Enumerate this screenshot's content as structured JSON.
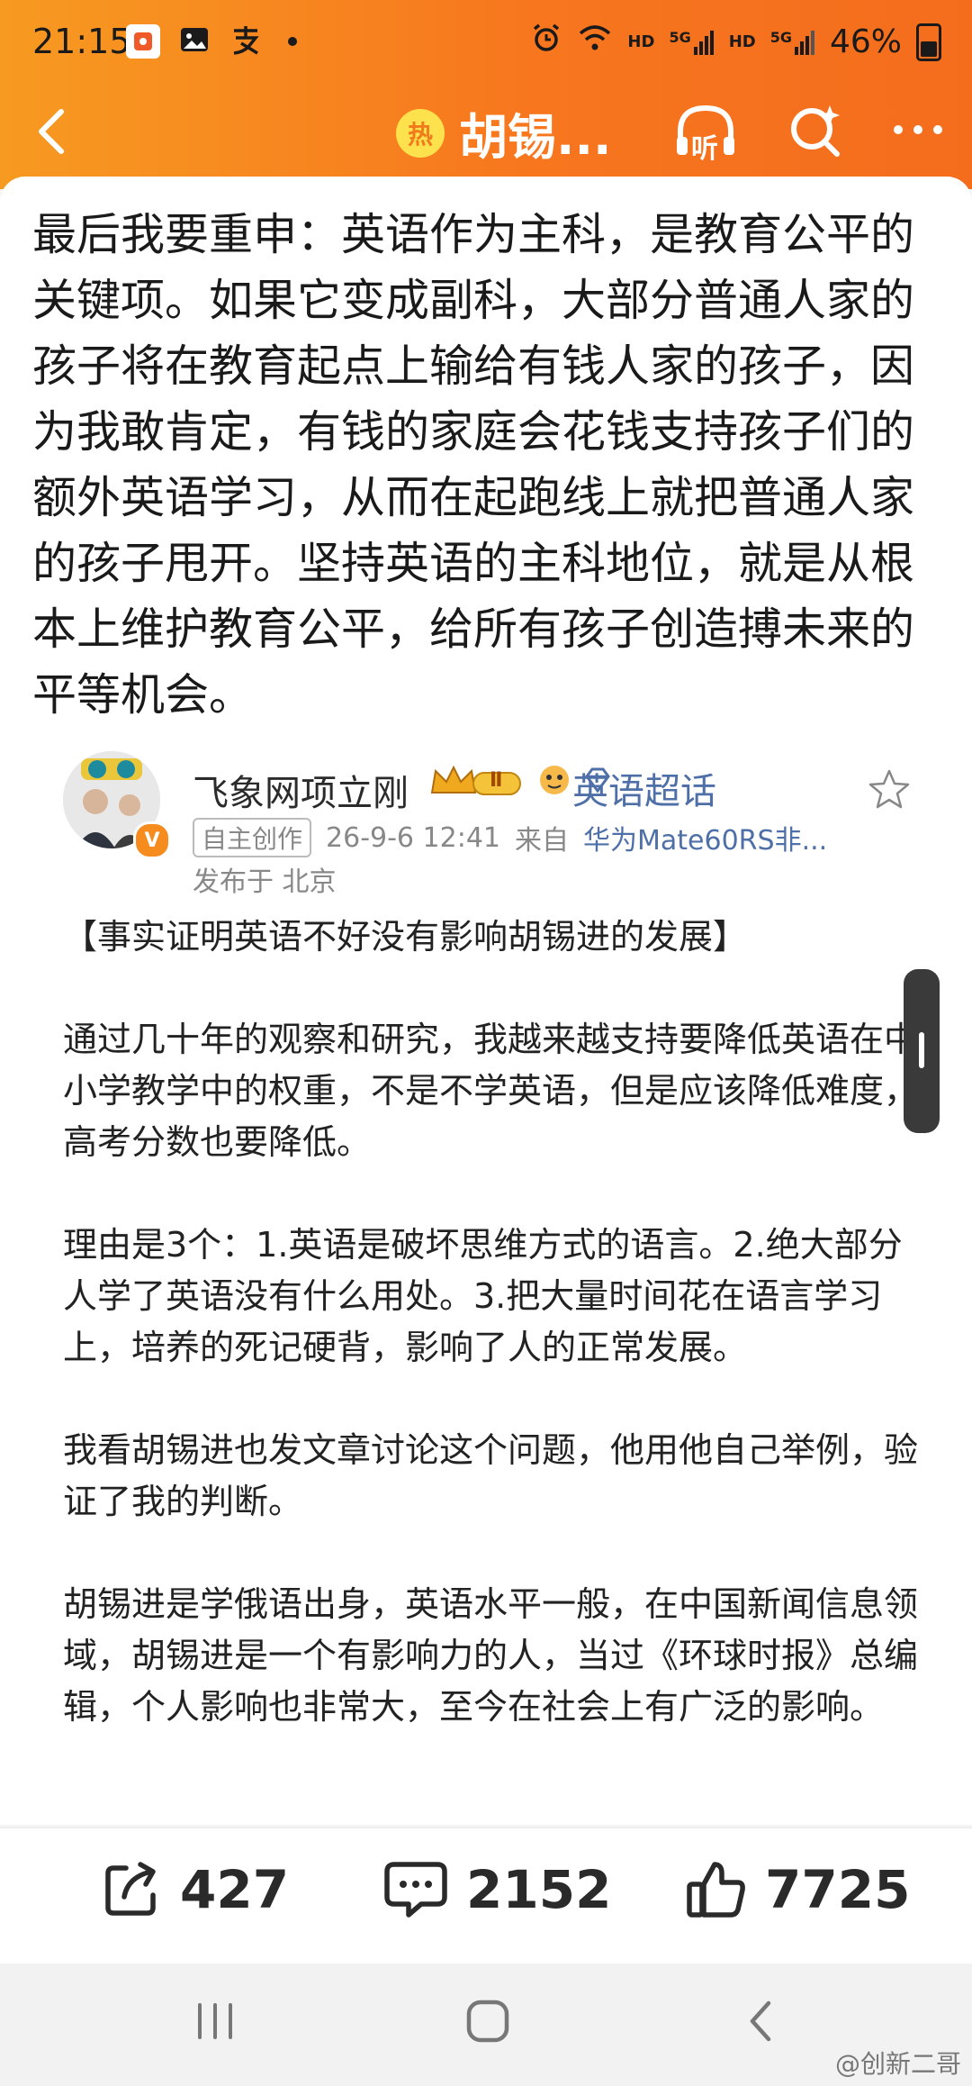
{
  "status_bar": {
    "time": "21:15",
    "battery": "46%",
    "hd1": "HD",
    "hd2": "HD",
    "sig1": "5G",
    "sig2": "5G"
  },
  "nav": {
    "hot_badge": "热",
    "title": "胡锡...",
    "listen_label": "听"
  },
  "article": {
    "paragraph": "最后我要重申：英语作为主科，是教育公平的关键项。如果它变成副科，大部分普通人家的孩子将在教育起点上输给有钱人家的孩子，因为我敢肯定，有钱的家庭会花钱支持孩子们的额外英语学习，从而在起跑线上就把普通人家的孩子甩开。坚持英语的主科地位，就是从根本上维护教育公平，给所有孩子创造搏未来的平等机会。"
  },
  "embedded_post": {
    "username": "飞象网项立刚",
    "level_badge": "Ⅱ",
    "super_topic": "英语超话",
    "original_tag": "自主创作",
    "timestamp": "26-9-6 12:41",
    "source_prefix": "来自",
    "device": "华为Mate60RS非...",
    "location": "发布于 北京",
    "body": "【事实证明英语不好没有影响胡锡进的发展】\n\n通过几十年的观察和研究，我越来越支持要降低英语在中小学教学中的权重，不是不学英语，但是应该降低难度，高考分数也要降低。\n\n理由是3个：1.英语是破坏思维方式的语言。2.绝大部分人学了英语没有什么用处。3.把大量时间花在语言学习上，培养的死记硬背，影响了人的正常发展。\n\n我看胡锡进也发文章讨论这个问题，他用他自己举例，验证了我的判断。\n\n胡锡进是学俄语出身，英语水平一般，在中国新闻信息领域，胡锡进是一个有影响力的人，当过《环球时报》总编辑，个人影响也非常大，至今在社会上有广泛的影响。"
  },
  "actions": {
    "share_count": "427",
    "comment_count": "2152",
    "like_count": "7725"
  },
  "watermark": "@创新二哥",
  "colors": {
    "header_orange": "#f7761e",
    "link_blue": "#4e6fa8"
  }
}
